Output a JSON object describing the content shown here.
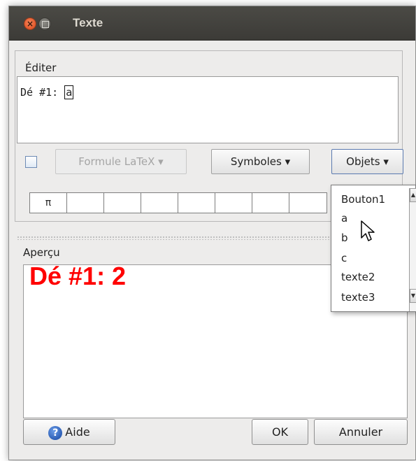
{
  "window": {
    "title": "Texte"
  },
  "edit_group": {
    "label": "Éditer",
    "content_prefix": "Dé #1: ",
    "inserted_object": "a"
  },
  "toolbar": {
    "latex_checkbox_checked": false,
    "latex_label": "Formule LaTeX ▾",
    "symbols_label": "Symboles ▾",
    "objects_label": "Objets ▾"
  },
  "symbol_bar": {
    "first_symbol": "π"
  },
  "preview_group": {
    "label": "Aperçu",
    "rendered_text": "Dé #1: 2",
    "text_color": "#ff0000"
  },
  "objects_menu": {
    "items": [
      "Bouton1",
      "a",
      "b",
      "c",
      "texte2",
      "texte3"
    ]
  },
  "buttons": {
    "help_label": "Aide",
    "ok_label": "OK",
    "cancel_label": "Annuler"
  }
}
